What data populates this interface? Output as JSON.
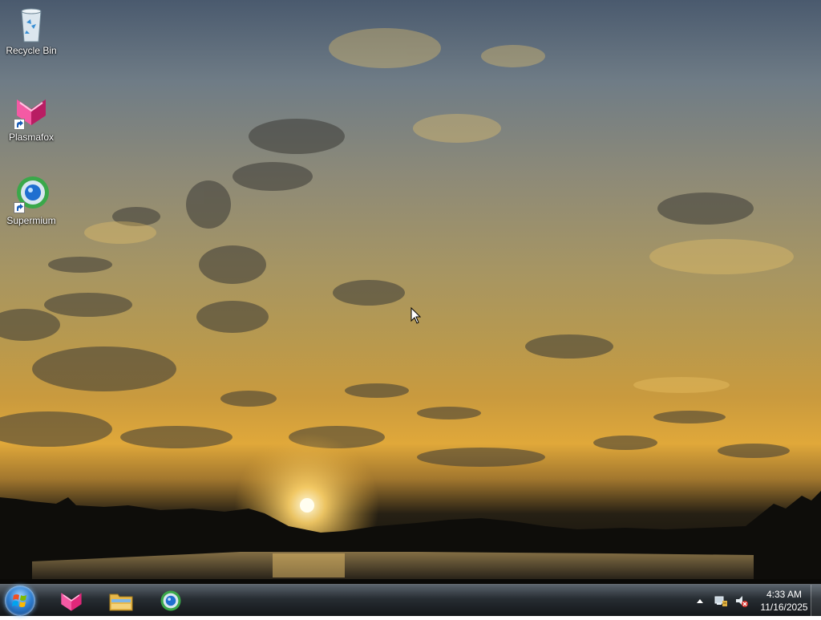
{
  "desktop": {
    "icons": [
      {
        "label": "Recycle Bin",
        "icon": "recycle-bin-icon"
      },
      {
        "label": "Plasmafox",
        "icon": "plasmafox-icon"
      },
      {
        "label": "Supermium",
        "icon": "supermium-icon"
      }
    ]
  },
  "taskbar": {
    "start_icon": "windows-start-orb",
    "pinned": [
      {
        "icon": "plasmafox-icon"
      },
      {
        "icon": "file-explorer-icon"
      },
      {
        "icon": "supermium-icon"
      }
    ],
    "tray": {
      "icons": [
        "show-hidden-icons-arrow",
        "network-icon",
        "volume-muted-icon"
      ],
      "time": "4:33 AM",
      "date": "11/16/2025"
    }
  },
  "colors": {
    "plasmafox": "#e0287a",
    "supermium_ring": "#3aa84a",
    "supermium_core": "#1f6fd0",
    "start_orb": "#2f7fd1"
  }
}
